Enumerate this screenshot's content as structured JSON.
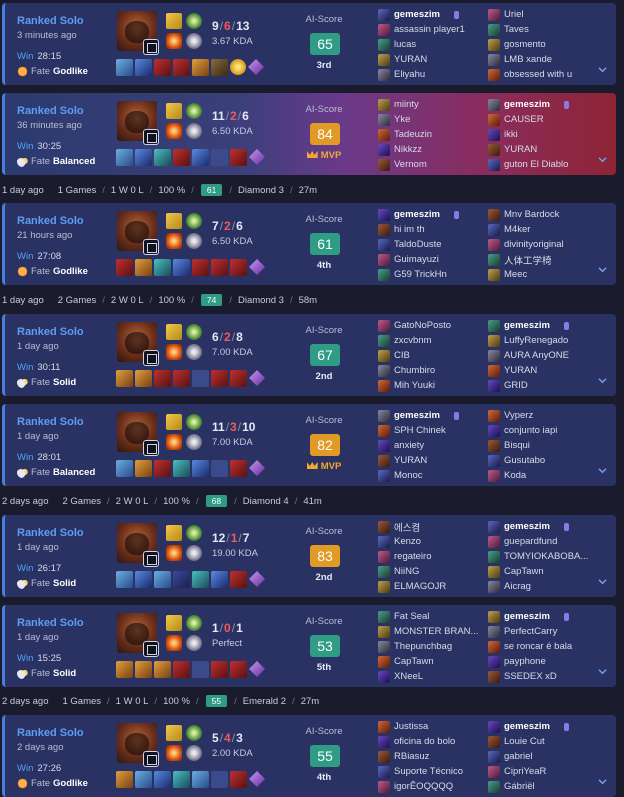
{
  "colors": {
    "win_accent": "#4a7de0",
    "lp_badge": "#2f9c85",
    "ai_green": "#2f9c85",
    "ai_gold": "#e09a25",
    "deaths": "#f05a5a"
  },
  "separators": [
    {
      "day": "1 day ago",
      "games": "1 Games",
      "record": "1 W 0 L",
      "winrate": "100 %",
      "lp": "61",
      "rank": "Diamond 3",
      "duration": "27m"
    },
    {
      "day": "1 day ago",
      "games": "2 Games",
      "record": "2 W 0 L",
      "winrate": "100 %",
      "lp": "74",
      "rank": "Diamond 3",
      "duration": "58m"
    },
    {
      "day": "2 days ago",
      "games": "2 Games",
      "record": "2 W 0 L",
      "winrate": "100 %",
      "lp": "68",
      "rank": "Diamond 4",
      "duration": "41m"
    },
    {
      "day": "2 days ago",
      "games": "1 Games",
      "record": "1 W 0 L",
      "winrate": "100 %",
      "lp": "55",
      "rank": "Emerald 2",
      "duration": "27m"
    }
  ],
  "matches": [
    {
      "mode": "Ranked Solo",
      "ago": "3 minutes ago",
      "result": "Win",
      "duration": "28:15",
      "fate_label": "Fate",
      "fate": "Godlike",
      "fate_icon": "sun-icon",
      "k": "9",
      "d": "6",
      "a": "13",
      "kda": "3.67 KDA",
      "ai_label": "AI-Score",
      "ai_score": "65",
      "ai_color": "green",
      "rank": "3rd",
      "mvp": false,
      "team1": [
        "gemeszim",
        "assassin player1",
        "lucas",
        "YURAN",
        "Eliyahu"
      ],
      "team2": [
        "Uriel",
        "Taves",
        "gosmento",
        "LMB xande",
        "obsessed with u"
      ],
      "me_team": 1,
      "me_index": 0
    },
    {
      "mode": "Ranked Solo",
      "ago": "36 minutes ago",
      "result": "Win",
      "duration": "30:25",
      "fate_label": "Fate",
      "fate": "Balanced",
      "fate_icon": "cloud-icon",
      "k": "11",
      "d": "2",
      "a": "6",
      "kda": "6.50 KDA",
      "ai_label": "AI-Score",
      "ai_score": "84",
      "ai_color": "gold",
      "rank": "MVP",
      "mvp": true,
      "team1": [
        "miinty",
        "Yke",
        "Tadeuzin",
        "Nikkzz",
        "Vernom"
      ],
      "team2": [
        "gemeszim",
        "CAUSER",
        "ikki",
        "YURAN",
        "guton El Diablo"
      ],
      "me_team": 2,
      "me_index": 0
    },
    {
      "mode": "Ranked Solo",
      "ago": "21 hours ago",
      "result": "Win",
      "duration": "27:08",
      "fate_label": "Fate",
      "fate": "Godlike",
      "fate_icon": "sun-icon",
      "k": "7",
      "d": "2",
      "a": "6",
      "kda": "6.50 KDA",
      "ai_label": "AI-Score",
      "ai_score": "61",
      "ai_color": "green",
      "rank": "4th",
      "mvp": false,
      "team1": [
        "gemeszim",
        "hi im th",
        "TaldoDuste",
        "Guimayuzi",
        "G59 TrickHn"
      ],
      "team2": [
        "Mnv Bardock",
        "M4ker",
        "divinityoriginal",
        "人体工学椅",
        "Meec"
      ],
      "me_team": 1,
      "me_index": 0
    },
    {
      "mode": "Ranked Solo",
      "ago": "1 day ago",
      "result": "Win",
      "duration": "30:11",
      "fate_label": "Fate",
      "fate": "Solid",
      "fate_icon": "cloud-icon",
      "k": "6",
      "d": "2",
      "a": "8",
      "kda": "7.00 KDA",
      "ai_label": "AI-Score",
      "ai_score": "67",
      "ai_color": "green",
      "rank": "2nd",
      "mvp": false,
      "team1": [
        "GatoNoPosto",
        "zxcvbnm",
        "CIB",
        "Chumbiro",
        "Mih Yuuki"
      ],
      "team2": [
        "gemeszim",
        "LuffyRenegado",
        "AURA AnyONE",
        "YURAN",
        "GRID"
      ],
      "me_team": 2,
      "me_index": 0
    },
    {
      "mode": "Ranked Solo",
      "ago": "1 day ago",
      "result": "Win",
      "duration": "28:01",
      "fate_label": "Fate",
      "fate": "Balanced",
      "fate_icon": "cloud-icon",
      "k": "11",
      "d": "3",
      "a": "10",
      "kda": "7.00 KDA",
      "ai_label": "AI-Score",
      "ai_score": "82",
      "ai_color": "gold",
      "rank": "MVP",
      "mvp": false,
      "team1": [
        "gemeszim",
        "SPH Chinek",
        "anxiety",
        "YURAN",
        "Monoc"
      ],
      "team2": [
        "Vyperz",
        "conjunto iapi",
        "Bisqui",
        "Gusutabo",
        "Koda"
      ],
      "me_team": 1,
      "me_index": 0
    },
    {
      "mode": "Ranked Solo",
      "ago": "1 day ago",
      "result": "Win",
      "duration": "26:17",
      "fate_label": "Fate",
      "fate": "Solid",
      "fate_icon": "cloud-icon",
      "k": "12",
      "d": "1",
      "a": "7",
      "kda": "19.00 KDA",
      "ai_label": "AI-Score",
      "ai_score": "83",
      "ai_color": "gold",
      "rank": "2nd",
      "mvp": false,
      "team1": [
        "에스켬",
        "Kenzo",
        "regateiro",
        "NiiNG",
        "ELMAGOJR"
      ],
      "team2": [
        "gemeszim",
        "guepardfund",
        "TOMYIOKABOBA...",
        "CapTawn",
        "Aicrag"
      ],
      "me_team": 2,
      "me_index": 0
    },
    {
      "mode": "Ranked Solo",
      "ago": "1 day ago",
      "result": "Win",
      "duration": "15:25",
      "fate_label": "Fate",
      "fate": "Solid",
      "fate_icon": "cloud-icon",
      "k": "1",
      "d": "0",
      "a": "1",
      "kda": "Perfect",
      "ai_label": "AI-Score",
      "ai_score": "53",
      "ai_color": "green",
      "rank": "5th",
      "mvp": false,
      "team1": [
        "Fat Seal",
        "MONSTER BRAN...",
        "Thepunchbag",
        "CapTawn",
        "XNeeL"
      ],
      "team2": [
        "gemeszim",
        "PerfectCarry",
        "se roncar é bala",
        "payphone",
        "SSEDEX xD"
      ],
      "me_team": 2,
      "me_index": 0
    },
    {
      "mode": "Ranked Solo",
      "ago": "2 days ago",
      "result": "Win",
      "duration": "27:26",
      "fate_label": "Fate",
      "fate": "Godlike",
      "fate_icon": "sun-icon",
      "k": "5",
      "d": "4",
      "a": "3",
      "kda": "2.00 KDA",
      "ai_label": "AI-Score",
      "ai_score": "55",
      "ai_color": "green",
      "rank": "4th",
      "mvp": false,
      "team1": [
        "Justissa",
        "oficina do bolo",
        "RBiasuz",
        "Suporte Técnico",
        "igorÊOQQQQ"
      ],
      "team2": [
        "gemeszim",
        "Louie Cut",
        "gabriel",
        "CipriYeaR",
        "Gábriël"
      ],
      "me_team": 2,
      "me_index": 0
    }
  ]
}
